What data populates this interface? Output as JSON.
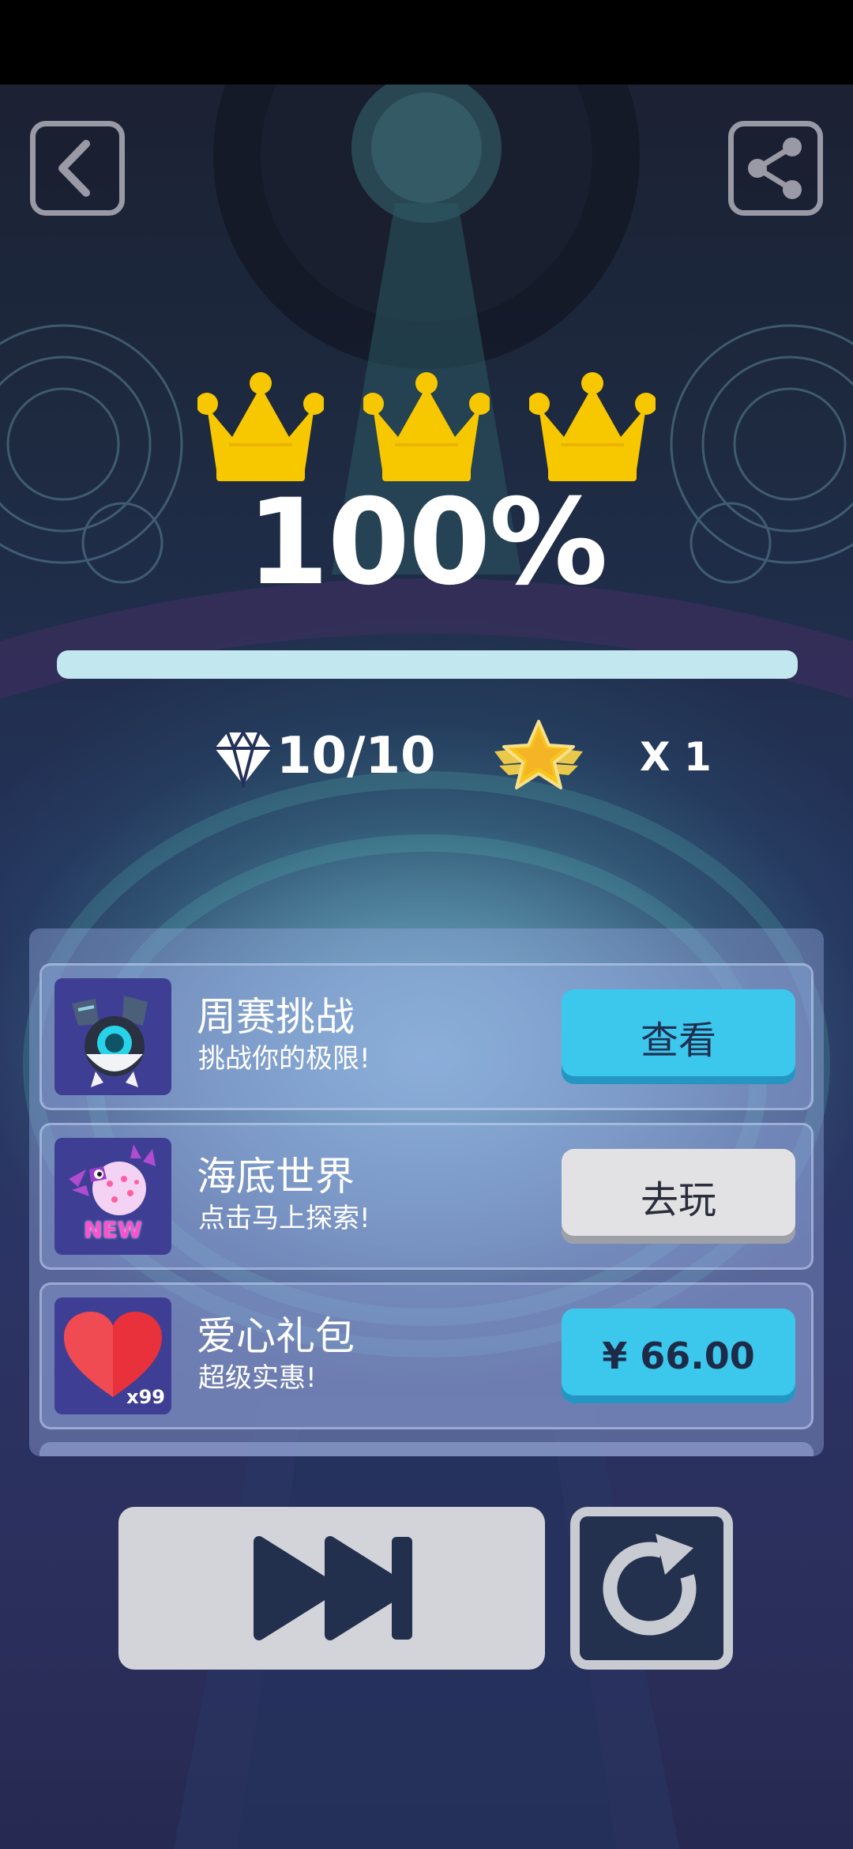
{
  "result": {
    "crowns_earned": 3,
    "crowns_total": 3,
    "percent_text": "100%",
    "progress_fraction": 1.0,
    "gems_text": "10/10",
    "star_multiplier_text": "X 1"
  },
  "offers": [
    {
      "title": "周赛挑战",
      "subtitle": "挑战你的极限!",
      "button": "查看",
      "button_style": "blue",
      "icon": "robot-character-icon"
    },
    {
      "title": "海底世界",
      "subtitle": "点击马上探索!",
      "button": "去玩",
      "button_style": "gray",
      "icon": "pufferfish-icon",
      "badge": "NEW"
    },
    {
      "title": "爱心礼包",
      "subtitle": "超级实惠!",
      "button": "¥ 66.00",
      "button_style": "blue",
      "icon": "heart-icon",
      "badge": "x99"
    }
  ],
  "icons": {
    "back": "back-arrow-icon",
    "share": "share-icon",
    "next": "skip-forward-icon",
    "replay": "replay-icon",
    "gem": "diamond-icon",
    "star": "winged-star-icon",
    "crown": "crown-icon"
  },
  "colors": {
    "crown": "#f7c700",
    "accent_button": "#3cc7ec",
    "progress_fill": "#c3e7ee",
    "dark_navy": "#23304e"
  }
}
